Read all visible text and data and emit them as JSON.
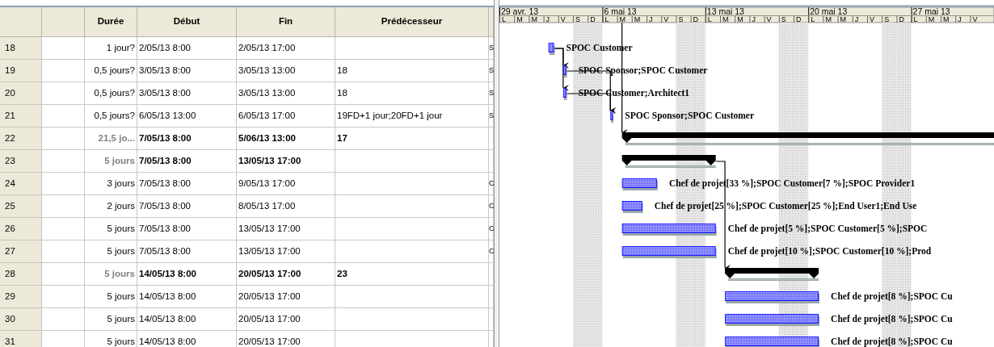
{
  "table": {
    "columns": [
      {
        "label": "Durée"
      },
      {
        "label": "Début"
      },
      {
        "label": "Fin"
      },
      {
        "label": "Prédécesseur"
      }
    ],
    "rows": [
      {
        "id": "18",
        "kind": "task",
        "duration": "1 jour?",
        "start": "2/05/13 8:00",
        "finish": "2/05/13 17:00",
        "column_6": "S",
        "resources": "SPOC Customer"
      },
      {
        "id": "19",
        "kind": "task",
        "duration": "0,5 jours?",
        "start": "3/05/13 8:00",
        "finish": "3/05/13 13:00",
        "predecessors": "18",
        "column_6": "S",
        "resources": "SPOC Sponsor;SPOC Customer"
      },
      {
        "id": "20",
        "kind": "task",
        "duration": "0,5 jours?",
        "start": "3/05/13 8:00",
        "finish": "3/05/13 13:00",
        "predecessors": "18",
        "column_6": "S",
        "resources": "SPOC Customer;Architect1"
      },
      {
        "id": "21",
        "kind": "task",
        "duration": "0,5 jours?",
        "start": "6/05/13 13:00",
        "finish": "6/05/13 17:00",
        "predecessors": "19FD+1 jour;20FD+1 jour",
        "column_6": "S",
        "resources": "SPOC Sponsor;SPOC Customer"
      },
      {
        "id": "22",
        "kind": "summary",
        "duration": "21,5 jo...",
        "start": "7/05/13 8:00",
        "finish": "5/06/13 13:00",
        "predecessors": "17"
      },
      {
        "id": "23",
        "kind": "summary",
        "duration": "5 jours",
        "start": "7/05/13 8:00",
        "finish": "13/05/13 17:00"
      },
      {
        "id": "24",
        "kind": "task",
        "duration": "3 jours",
        "start": "7/05/13 8:00",
        "finish": "9/05/13 17:00",
        "column_6": "C",
        "resources": "Chef de projet[33 %];SPOC Customer[7 %];SPOC Provider1"
      },
      {
        "id": "25",
        "kind": "task",
        "duration": "2 jours",
        "start": "7/05/13 8:00",
        "finish": "8/05/13 17:00",
        "column_6": "C",
        "resources": "Chef de projet[25 %];SPOC Customer[25 %];End User1;End Use"
      },
      {
        "id": "26",
        "kind": "task",
        "duration": "5 jours",
        "start": "7/05/13 8:00",
        "finish": "13/05/13 17:00",
        "column_6": "C",
        "resources": "Chef de projet[5 %];SPOC Customer[5 %];SPOC"
      },
      {
        "id": "27",
        "kind": "task",
        "duration": "5 jours",
        "start": "7/05/13 8:00",
        "finish": "13/05/13 17:00",
        "column_6": "C",
        "resources": "Chef de projet[10 %];SPOC Customer[10 %];Prod"
      },
      {
        "id": "28",
        "kind": "summary",
        "duration": "5 jours",
        "start": "14/05/13 8:00",
        "finish": "20/05/13 17:00",
        "predecessors": "23"
      },
      {
        "id": "29",
        "kind": "task",
        "duration": "5 jours",
        "start": "14/05/13 8:00",
        "finish": "20/05/13 17:00",
        "resources": "Chef de projet[8 %];SPOC Cu"
      },
      {
        "id": "30",
        "kind": "task",
        "duration": "5 jours",
        "start": "14/05/13 8:00",
        "finish": "20/05/13 17:00",
        "resources": "Chef de projet[8 %];SPOC Cu"
      },
      {
        "id": "31",
        "kind": "task",
        "duration": "5 jours",
        "start": "14/05/13 8:00",
        "finish": "20/05/13 17:00",
        "resources": "Chef de projet[8 %];SPOC Cu"
      }
    ]
  },
  "timescale": {
    "weeks": [
      {
        "label": "29 avr. 13",
        "days": [
          "L",
          "M",
          "M",
          "J",
          "V",
          "S",
          "D"
        ]
      },
      {
        "label": "6 mai 13",
        "days": [
          "L",
          "M",
          "M",
          "J",
          "V",
          "S",
          "D"
        ]
      },
      {
        "label": "13 mai 13",
        "days": [
          "L",
          "M",
          "M",
          "J",
          "V",
          "S",
          "D"
        ]
      },
      {
        "label": "20 mai 13",
        "days": [
          "L",
          "M",
          "M",
          "J",
          "V",
          "S",
          "D"
        ]
      },
      {
        "label": "27 mai 13",
        "days": [
          "L",
          "M",
          "M",
          "J",
          "V"
        ]
      }
    ]
  }
}
